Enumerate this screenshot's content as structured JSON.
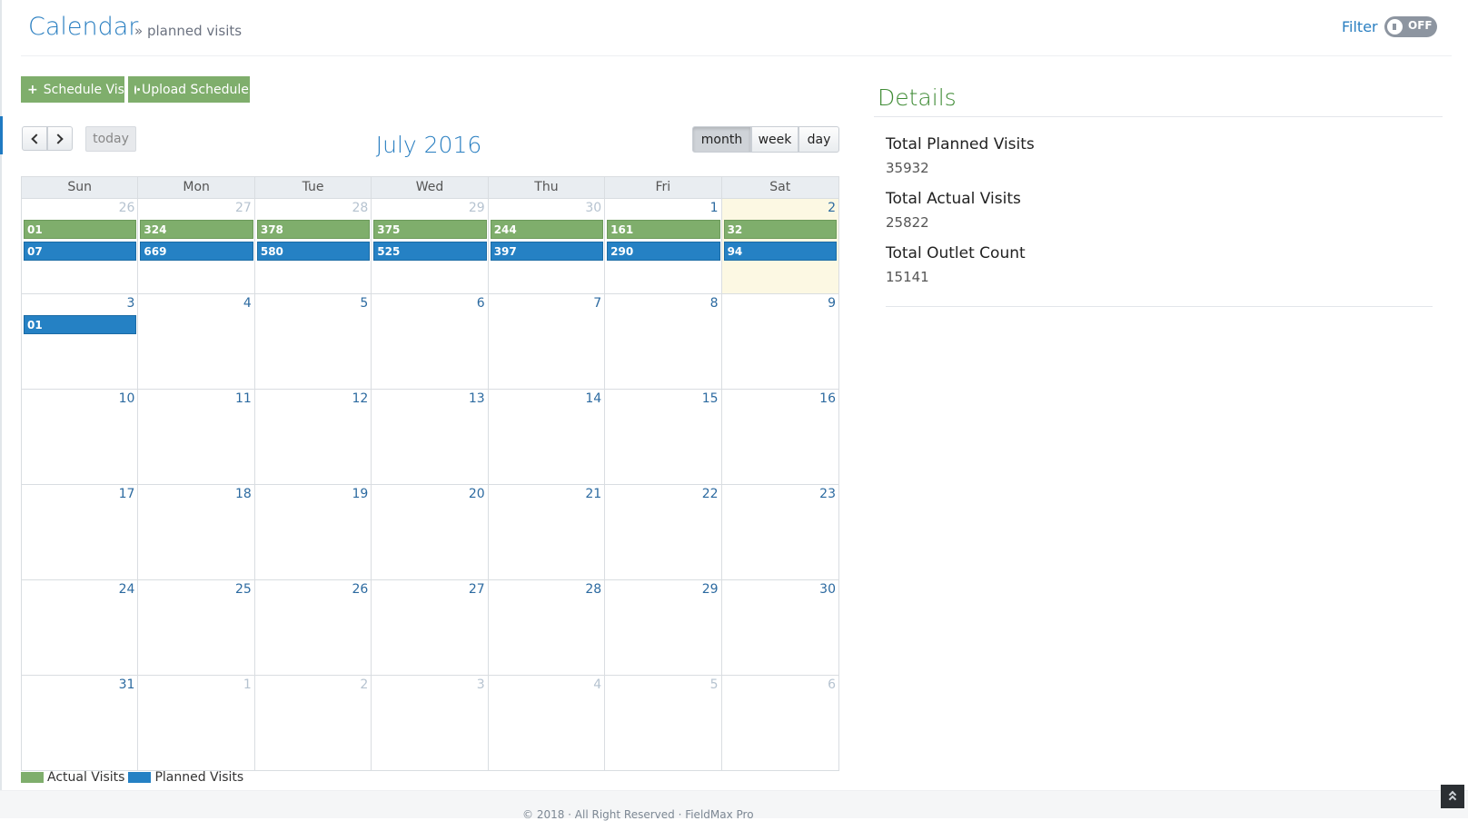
{
  "header": {
    "title": "Calendar",
    "breadcrumb": "» planned visits",
    "filter_label": "Filter",
    "toggle_text": "OFF"
  },
  "actions": {
    "schedule_label": "Schedule Visit",
    "upload_label": "Upload Schedule"
  },
  "calendar": {
    "title": "July 2016",
    "today_label": "today",
    "views": [
      "month",
      "week",
      "day"
    ],
    "active_view": "month",
    "weekdays": [
      "Sun",
      "Mon",
      "Tue",
      "Wed",
      "Thu",
      "Fri",
      "Sat"
    ],
    "weeks": [
      {
        "days": [
          {
            "n": "26",
            "other": true
          },
          {
            "n": "27",
            "other": true
          },
          {
            "n": "28",
            "other": true
          },
          {
            "n": "29",
            "other": true
          },
          {
            "n": "30",
            "other": true
          },
          {
            "n": "1"
          },
          {
            "n": "2",
            "today": true
          }
        ],
        "actual": [
          "01",
          "324",
          "378",
          "375",
          "244",
          "161",
          "32"
        ],
        "planned": [
          "07",
          "669",
          "580",
          "525",
          "397",
          "290",
          "94"
        ]
      },
      {
        "days": [
          {
            "n": "3"
          },
          {
            "n": "4"
          },
          {
            "n": "5"
          },
          {
            "n": "6"
          },
          {
            "n": "7"
          },
          {
            "n": "8"
          },
          {
            "n": "9"
          }
        ],
        "actual": [],
        "planned": [
          "01"
        ]
      },
      {
        "days": [
          {
            "n": "10"
          },
          {
            "n": "11"
          },
          {
            "n": "12"
          },
          {
            "n": "13"
          },
          {
            "n": "14"
          },
          {
            "n": "15"
          },
          {
            "n": "16"
          }
        ],
        "actual": [],
        "planned": []
      },
      {
        "days": [
          {
            "n": "17"
          },
          {
            "n": "18"
          },
          {
            "n": "19"
          },
          {
            "n": "20"
          },
          {
            "n": "21"
          },
          {
            "n": "22"
          },
          {
            "n": "23"
          }
        ],
        "actual": [],
        "planned": []
      },
      {
        "days": [
          {
            "n": "24"
          },
          {
            "n": "25"
          },
          {
            "n": "26"
          },
          {
            "n": "27"
          },
          {
            "n": "28"
          },
          {
            "n": "29"
          },
          {
            "n": "30"
          }
        ],
        "actual": [],
        "planned": []
      },
      {
        "days": [
          {
            "n": "31"
          },
          {
            "n": "1",
            "other": true
          },
          {
            "n": "2",
            "other": true
          },
          {
            "n": "3",
            "other": true
          },
          {
            "n": "4",
            "other": true
          },
          {
            "n": "5",
            "other": true
          },
          {
            "n": "6",
            "other": true
          }
        ],
        "actual": [],
        "planned": []
      }
    ]
  },
  "legend": {
    "actual_label": "Actual Visits",
    "planned_label": "Planned Visits",
    "actual_color": "#7fae6c",
    "planned_color": "#2581c4"
  },
  "details": {
    "title": "Details",
    "stats": [
      {
        "label": "Total Planned Visits",
        "value": "35932"
      },
      {
        "label": "Total Actual Visits",
        "value": "25822"
      },
      {
        "label": "Total Outlet Count",
        "value": "15141"
      }
    ]
  },
  "footer": {
    "text": "© 2018 · All Right Reserved · FieldMax Pro"
  }
}
